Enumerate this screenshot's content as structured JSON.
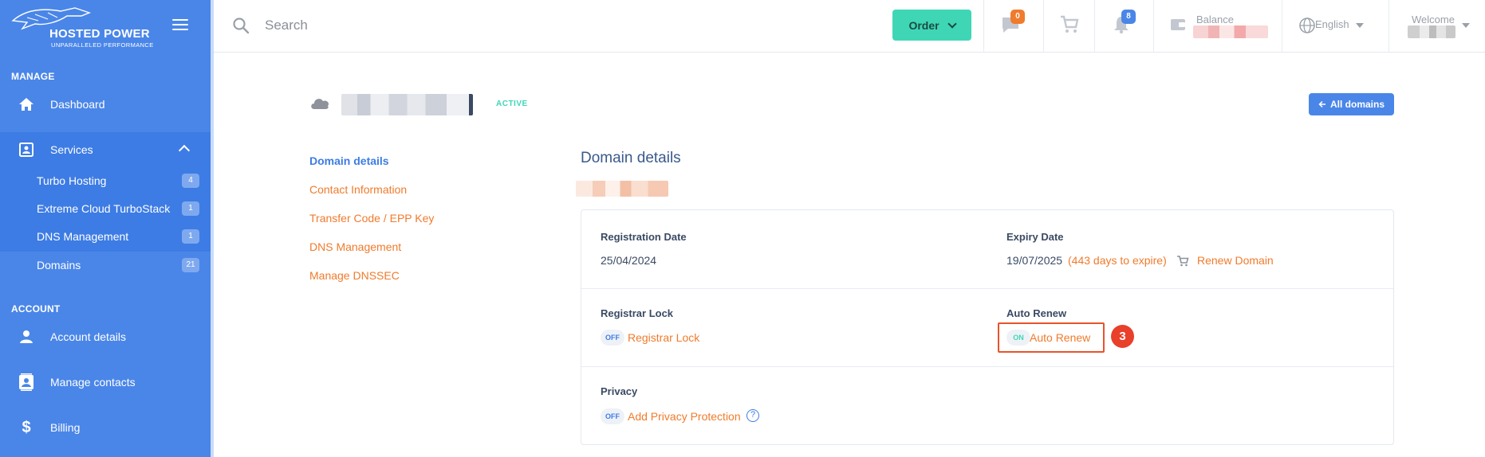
{
  "brand": {
    "title": "HOSTED POWER",
    "subtitle": "UNPARALLELED PERFORMANCE"
  },
  "sidebar": {
    "manage_heading": "MANAGE",
    "account_heading": "ACCOUNT",
    "dashboard": "Dashboard",
    "services": "Services",
    "services_sub": [
      {
        "label": "Turbo Hosting",
        "count": "4"
      },
      {
        "label": "Extreme Cloud TurboStack",
        "count": "1"
      },
      {
        "label": "DNS Management",
        "count": "1"
      }
    ],
    "domains": {
      "label": "Domains",
      "count": "21"
    },
    "account_details": "Account details",
    "manage_contacts": "Manage contacts",
    "billing": "Billing"
  },
  "topbar": {
    "search_placeholder": "Search",
    "order_label": "Order",
    "messages_count": "0",
    "notifications_count": "8",
    "balance_label": "Balance",
    "language": "English",
    "welcome_label": "Welcome"
  },
  "domain": {
    "status": "ACTIVE",
    "all_domains_label": "All domains"
  },
  "subnav": [
    "Domain details",
    "Contact Information",
    "Transfer Code / EPP Key",
    "DNS Management",
    "Manage DNSSEC"
  ],
  "details": {
    "title": "Domain details",
    "registration_label": "Registration Date",
    "registration_value": "25/04/2024",
    "expiry_label": "Expiry Date",
    "expiry_value": "19/07/2025",
    "expiry_days": "(443 days to expire)",
    "renew_label": "Renew Domain",
    "registrar_lock_label": "Registrar Lock",
    "registrar_lock_state": "OFF",
    "registrar_lock_link": "Registrar Lock",
    "auto_renew_label": "Auto Renew",
    "auto_renew_state": "ON",
    "auto_renew_link": "Auto Renew",
    "privacy_label": "Privacy",
    "privacy_state": "OFF",
    "privacy_link": "Add Privacy Protection",
    "help_glyph": "?"
  },
  "annotation": {
    "step": "3"
  },
  "colors": {
    "sidebar": "#4a86e8",
    "accent_green": "#3fd6b6",
    "link_orange": "#f07b2c",
    "primary_blue": "#3d7ce4",
    "annotation_red": "#e8402a"
  },
  "icons": [
    "home-icon",
    "person-card-icon",
    "person-icon",
    "contacts-icon",
    "dollar-icon",
    "search-icon",
    "chat-icon",
    "cart-icon",
    "bell-icon",
    "wallet-icon",
    "globe-icon",
    "cloud-icon",
    "arrow-left-icon",
    "help-icon"
  ]
}
